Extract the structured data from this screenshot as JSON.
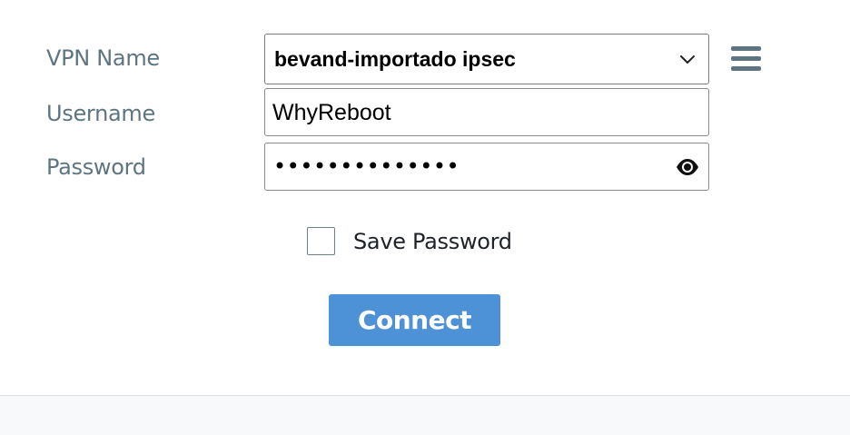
{
  "form": {
    "vpn_name_label": "VPN Name",
    "username_label": "Username",
    "password_label": "Password",
    "vpn_name_value": "bevand-importado ipsec",
    "username_value": "WhyReboot",
    "password_masked": "••••••••••••••",
    "save_password_label": "Save Password",
    "save_password_checked": false,
    "connect_label": "Connect"
  },
  "icons": {
    "menu": "hamburger-menu-icon",
    "select": "chevron-down-icon",
    "reveal_password": "eye-icon"
  },
  "colors": {
    "label_text": "#5d7581",
    "connect_button": "#4d91d6",
    "footer_bg": "#f8f9fb"
  }
}
